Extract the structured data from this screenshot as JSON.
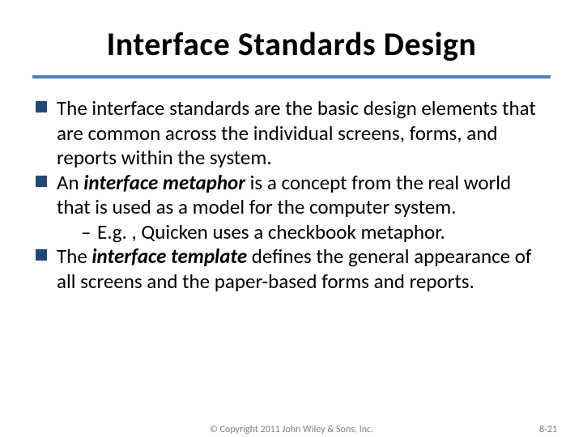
{
  "title": "Interface Standards Design",
  "bullets": [
    {
      "text": "The interface standards are the basic design elements that are common across the individual screens, forms, and reports within the system."
    },
    {
      "pre": "An ",
      "em": "interface metaphor",
      "post": " is a concept from the real world that is used as a model for the computer system.",
      "sub": [
        "E.g. , Quicken uses a checkbook metaphor."
      ]
    },
    {
      "pre": "The ",
      "em": "interface template",
      "post": " defines the general appearance of all screens and the paper-based forms and reports."
    }
  ],
  "footer": {
    "copyright": "© Copyright 2011 John Wiley & Sons, Inc.",
    "page": "8-21"
  }
}
